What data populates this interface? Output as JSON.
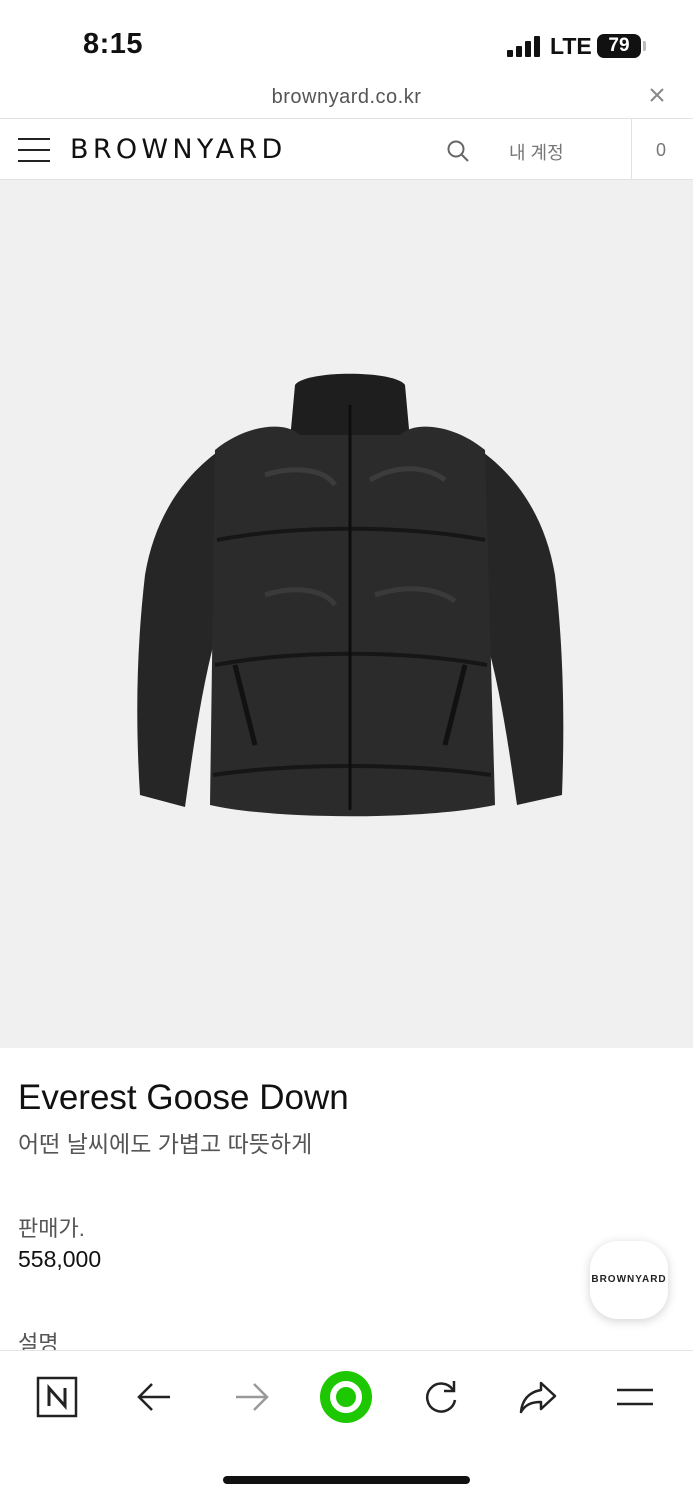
{
  "status_bar": {
    "time": "8:15",
    "network": "LTE",
    "battery": "79",
    "icons": [
      "signal-icon",
      "battery-icon"
    ]
  },
  "browser": {
    "url": "brownyard.co.kr",
    "icons": [
      "close-icon"
    ]
  },
  "header": {
    "logo": "BROWNYARD",
    "account_label": "내 계정",
    "cart_count": "0",
    "icons": [
      "menu-icon",
      "search-icon"
    ]
  },
  "product": {
    "image": "black-puffer-jacket",
    "title": "Everest Goose Down",
    "subtitle": "어떤 날씨에도 가볍고 따뜻하게",
    "price_label": "판매가.",
    "price": "558,000",
    "description_label": "설명"
  },
  "floating_button": {
    "label": "BROWNYARD"
  },
  "toolbar": {
    "icons": [
      "naver-n-icon",
      "back-arrow-icon",
      "forward-arrow-icon",
      "green-circle-icon",
      "refresh-icon",
      "share-icon",
      "hamburger-menu-icon"
    ]
  },
  "colors": {
    "image_background": "#f0f0f0",
    "accent_green": "#1ec800",
    "text_primary": "#111111",
    "text_secondary": "#555555"
  }
}
